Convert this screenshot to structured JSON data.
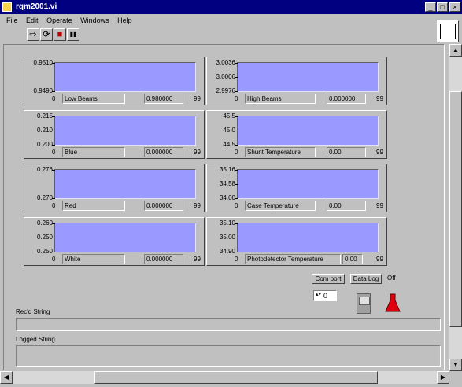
{
  "window": {
    "title": "rqm2001.vi",
    "min": "_",
    "max": "□",
    "close": "×"
  },
  "menu": [
    "File",
    "Edit",
    "Operate",
    "Windows",
    "Help"
  ],
  "toolbar": {
    "run": "⇨",
    "run_continuous": "⟳",
    "abort": "■",
    "pause": "▮▮"
  },
  "charts": [
    {
      "yticks": [
        "0.9510",
        "0.9490"
      ],
      "x_min": "0",
      "x_max": "99",
      "label": "Low Beams",
      "value": "0.980000"
    },
    {
      "yticks": [
        "3.0036",
        "3.0006",
        "2.9976"
      ],
      "x_min": "0",
      "x_max": "99",
      "label": "High Beams",
      "value": "0.000000"
    },
    {
      "yticks": [
        "0.215",
        "0.210",
        "0.200"
      ],
      "x_min": "0",
      "x_max": "99",
      "label": "Blue",
      "value": "0.000000"
    },
    {
      "yticks": [
        "45.5",
        "45.0",
        "44.5"
      ],
      "x_min": "0",
      "x_max": "99",
      "label": "Shunt Temperature",
      "value": "0.00"
    },
    {
      "yticks": [
        "0.276",
        "0.270"
      ],
      "x_min": "0",
      "x_max": "99",
      "label": "Red",
      "value": "0.000000"
    },
    {
      "yticks": [
        "35.16",
        "34.58",
        "34.00"
      ],
      "x_min": "0",
      "x_max": "99",
      "label": "Case Temperature",
      "value": "0.00"
    },
    {
      "yticks": [
        "0.260",
        "0.250",
        "0.250"
      ],
      "x_min": "0",
      "x_max": "99",
      "label": "White",
      "value": "0.000000"
    },
    {
      "yticks": [
        "35.10",
        "35.00",
        "34.90"
      ],
      "x_min": "0",
      "x_max": "99",
      "label": "Photodetector Temperature",
      "value": "0.00"
    }
  ],
  "controls": {
    "com_port_label": "Com port",
    "data_log_label": "Data Log",
    "data_log_value": "Off",
    "numeric_value": "0"
  },
  "strings": {
    "recd_label": "Rec'd String",
    "logged_label": "Logged String"
  }
}
